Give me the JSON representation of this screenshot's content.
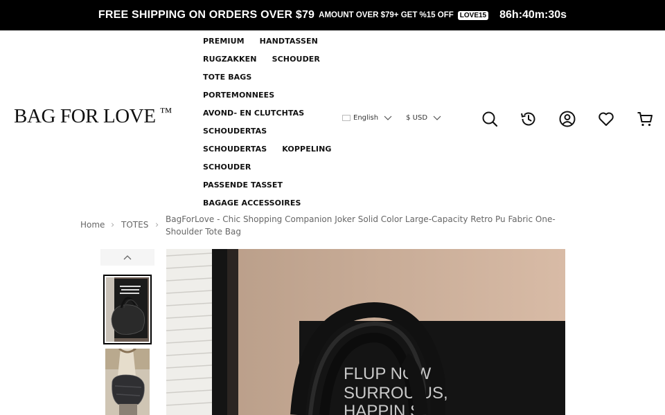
{
  "promo": {
    "main": "FREE SHIPPING ON ORDERS OVER $79",
    "sub": "AMOUNT OVER $79+ GET %15 OFF",
    "code": "LOVE15",
    "timer": "86h:40m:30s"
  },
  "header": {
    "logo": "BAG FOR LOVE",
    "logo_tm": "™"
  },
  "nav": {
    "rows": [
      [
        "PREMIUM",
        "HANDTASSEN"
      ],
      [
        "RUGZAKKEN",
        "SCHOUDER"
      ],
      [
        "TOTE BAGS"
      ],
      [
        "PORTEMONNEES"
      ],
      [
        "AVOND- EN CLUTCHTAS"
      ],
      [
        "SCHOUDERTAS"
      ],
      [
        "SCHOUDERTAS",
        "KOPPELING"
      ],
      [
        "SCHOUDER"
      ],
      [
        "PASSENDE TASSET"
      ],
      [
        "BAGAGE ACCESSOIRES"
      ]
    ]
  },
  "selectors": {
    "language": "English",
    "currency": "$ USD"
  },
  "icons": [
    "search-icon",
    "history-icon",
    "account-icon",
    "wishlist-heart-icon",
    "cart-icon"
  ],
  "breadcrumb": {
    "home": "Home",
    "category": "TOTES",
    "title": "BagForLove - Chic Shopping Companion Joker Solid Color Large-Capacity Retro Pu Fabric One-Shoulder Tote Bag"
  },
  "product_image": {
    "line1": "FLUP NOW",
    "line2": "SURROU   US,",
    "line3": "HAPPIN   S"
  }
}
